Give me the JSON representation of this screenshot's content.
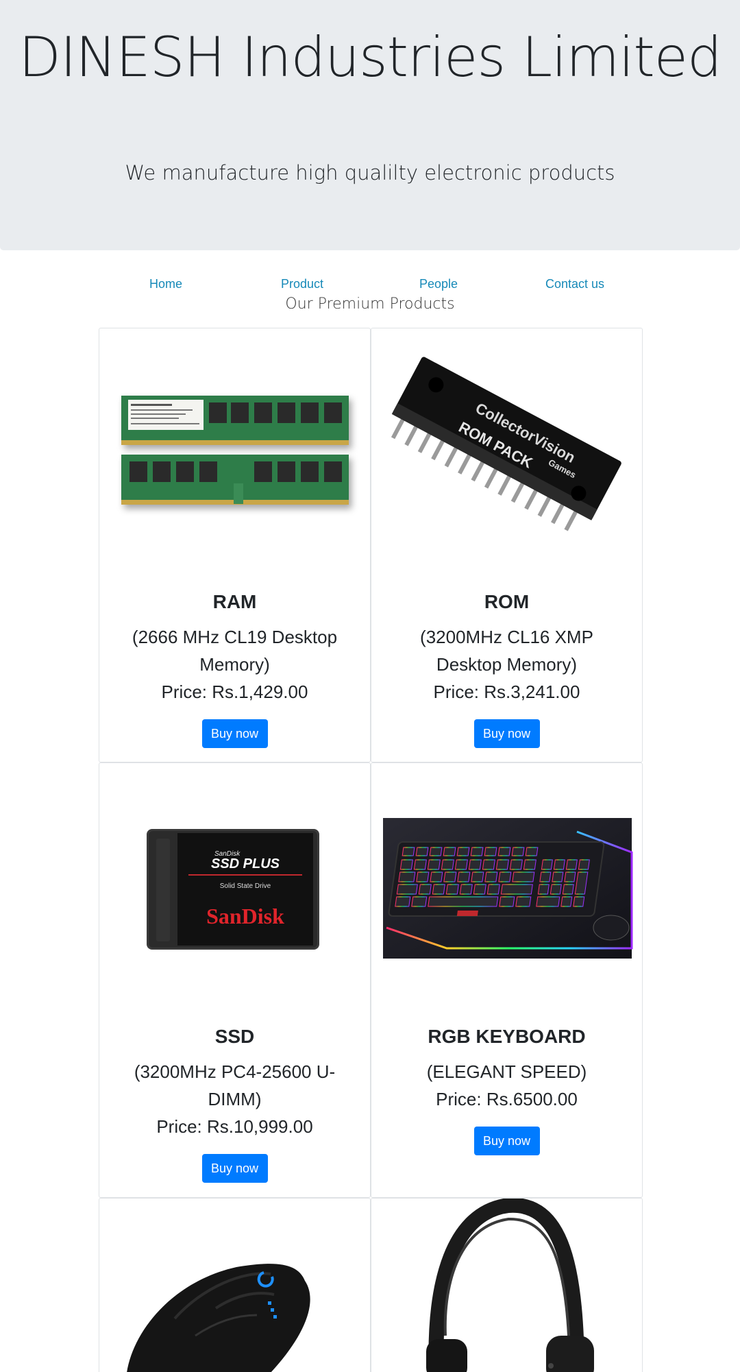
{
  "header": {
    "title": "DINESH Industries Limited",
    "tagline": "We manufacture high qualilty electronic products"
  },
  "nav": {
    "items": [
      {
        "label": "Home"
      },
      {
        "label": "Product"
      },
      {
        "label": "People"
      },
      {
        "label": "Contact us"
      }
    ]
  },
  "section": {
    "title": "Our Premium Products"
  },
  "products": [
    {
      "name": "RAM",
      "desc": "(2666 MHz CL19 Desktop Memory)",
      "price": "Price: Rs.1,429.00",
      "button": "Buy now",
      "image": "ram-module-image"
    },
    {
      "name": "ROM",
      "desc": "(3200MHz CL16 XMP Desktop Memory)",
      "price": "Price: Rs.3,241.00",
      "button": "Buy now",
      "image": "rom-chip-image",
      "chip_text_1": "CollectorVision",
      "chip_text_2": "Games",
      "chip_text_3": "ROM PACK"
    },
    {
      "name": "SSD",
      "desc": "(3200MHz PC4-25600 U-DIMM)",
      "price": "Price: Rs.10,999.00",
      "button": "Buy now",
      "image": "ssd-image",
      "ssd_brand_small": "SanDisk",
      "ssd_model": "SSD PLUS",
      "ssd_sub": "Solid State Drive",
      "ssd_brand": "SanDisk"
    },
    {
      "name": "RGB KEYBOARD",
      "desc": "(ELEGANT SPEED)",
      "price": "Price: Rs.6500.00",
      "button": "Buy now",
      "image": "rgb-keyboard-image"
    },
    {
      "name": "",
      "desc": "",
      "price": "",
      "button": "",
      "image": "gaming-mouse-image"
    },
    {
      "name": "",
      "desc": "",
      "price": "",
      "button": "",
      "image": "headphones-image"
    }
  ]
}
